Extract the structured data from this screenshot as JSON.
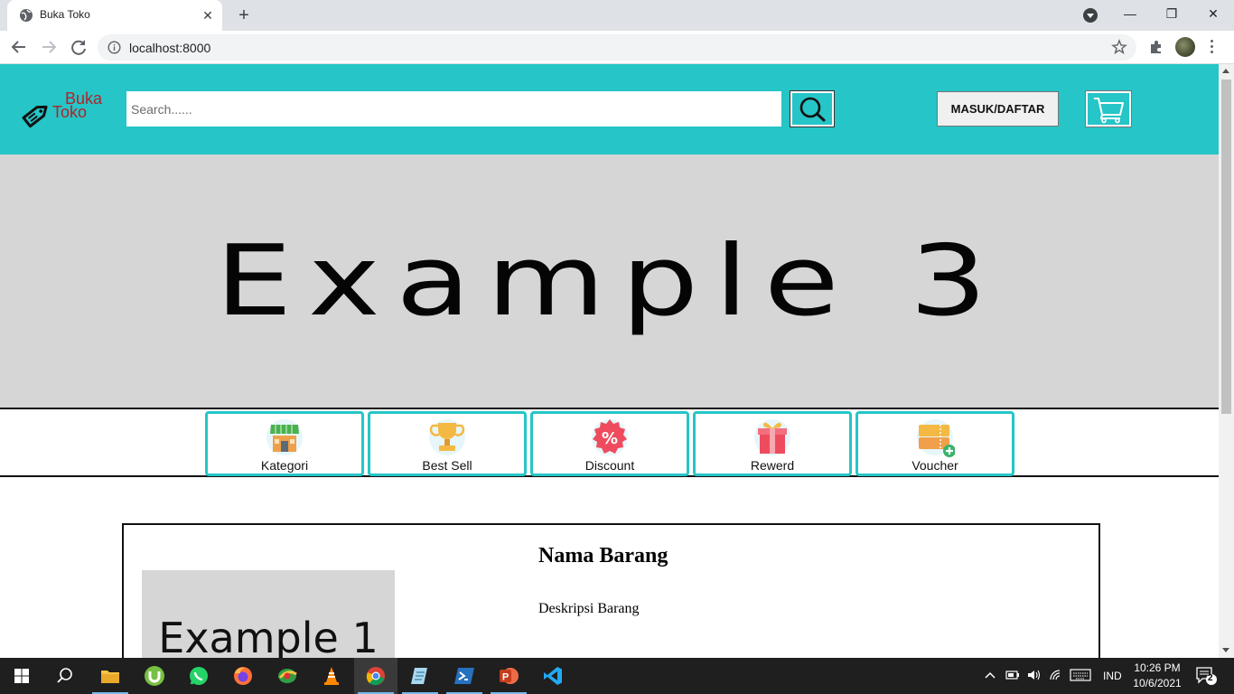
{
  "browser": {
    "tab_title": "Buka Toko",
    "tab_close": "✕",
    "new_tab": "+",
    "url": "localhost:8000",
    "window_controls": {
      "minimize": "—",
      "restore": "❐",
      "close": "✕"
    }
  },
  "site": {
    "brand_color": "#26c5c7",
    "logo": {
      "line1": "Buka",
      "line2": "Toko",
      "color": "#b0232a"
    },
    "search": {
      "placeholder": "Search......",
      "value": ""
    },
    "login_label": "MASUK/DAFTAR",
    "banner_text": "Example 3",
    "categories": [
      {
        "label": "Kategori",
        "icon": "store-icon"
      },
      {
        "label": "Best Sell",
        "icon": "trophy-icon"
      },
      {
        "label": "Discount",
        "icon": "discount-badge-icon"
      },
      {
        "label": "Rewerd",
        "icon": "gift-icon"
      },
      {
        "label": "Voucher",
        "icon": "voucher-icon"
      }
    ],
    "product": {
      "image_text": "Example 1",
      "title": "Nama Barang",
      "description": "Deskripsi Barang"
    }
  },
  "taskbar": {
    "apps": [
      "file-explorer",
      "utorrent",
      "whatsapp",
      "firefox",
      "ie-color",
      "vlc",
      "chrome",
      "notepad",
      "powershell",
      "powerpoint",
      "vscode"
    ],
    "language": "IND",
    "time": "10:26 PM",
    "date": "10/6/2021",
    "notification_count": "2"
  }
}
